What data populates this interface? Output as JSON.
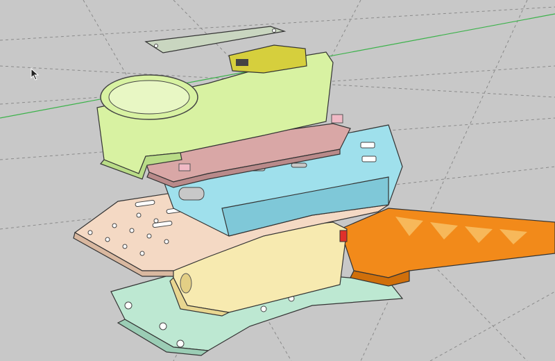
{
  "viewport": {
    "background": "#c8c8c8",
    "axis_green": "#3bb24a",
    "guide_line": "#8a8a8a"
  },
  "colors": {
    "top_cover": "#c9d6c0",
    "battery_box": "#d8f2a2",
    "battery_box_shade": "#b9dc87",
    "pcb": "#d6cf3d",
    "pink_plate": "#d9a7a6",
    "pink_plate_edge": "#b98a8a",
    "blue_bracket": "#9fe0ec",
    "blue_bracket_shade": "#7fc8d8",
    "wood_plate": "#f4d9c4",
    "wood_plate_edge": "#d9b8a0",
    "yellow_box": "#f7eab0",
    "yellow_box_shade": "#e8d690",
    "orange_arm": "#f28a1a",
    "orange_arm_shade": "#d06f0a",
    "base_frame": "#bde8d2",
    "base_frame_shade": "#9bcdb5"
  },
  "icons": {
    "cursor": "arrow-cursor-icon"
  }
}
